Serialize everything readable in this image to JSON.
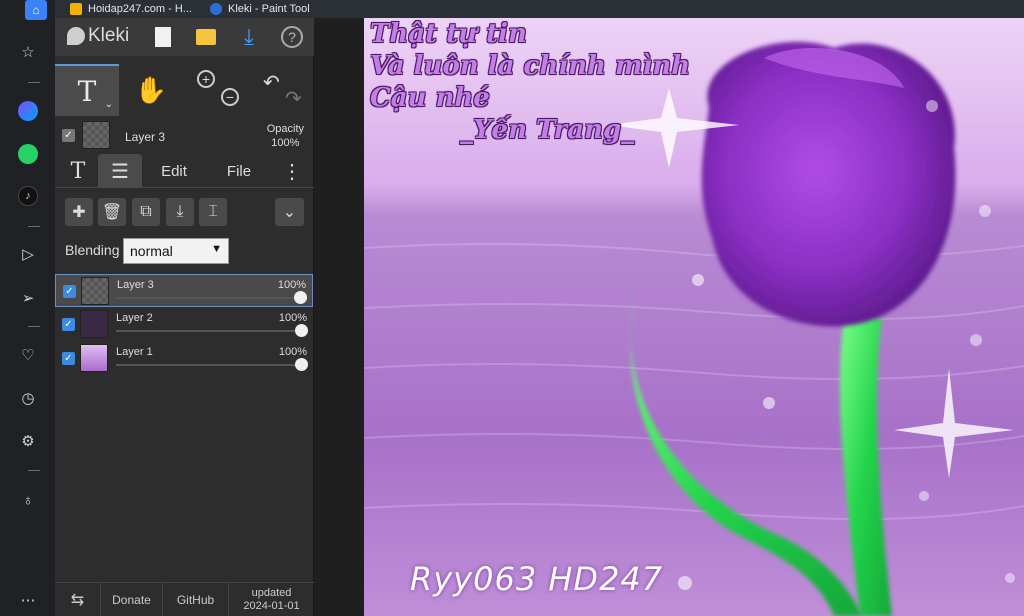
{
  "browser": {
    "tabs": [
      {
        "title": "Hoidap247.com - H..."
      },
      {
        "title": "Kleki - Paint Tool"
      }
    ]
  },
  "rail": {
    "icons": [
      "home-icon",
      "star-icon",
      "messenger-icon",
      "whatsapp-icon",
      "tiktok-icon",
      "play-icon",
      "send-icon",
      "heart-icon",
      "clock-icon",
      "settings-icon",
      "bulb-icon",
      "more-icon"
    ]
  },
  "kleki": {
    "logo": "Kleki",
    "tools": {
      "text_tool": "T"
    },
    "current_layer": {
      "name": "Layer 3",
      "opacity_label": "Opacity",
      "opacity_value": "100%"
    },
    "tabs": {
      "text": "T",
      "edit": "Edit",
      "file": "File"
    },
    "blending": {
      "label": "Blending",
      "value": "normal"
    },
    "layers": [
      {
        "name": "Layer 3",
        "opacity": "100%",
        "opacity_fraction": 1.0,
        "checked": true,
        "active": true
      },
      {
        "name": "Layer 2",
        "opacity": "100%",
        "opacity_fraction": 1.0,
        "checked": true,
        "active": false
      },
      {
        "name": "Layer 1",
        "opacity": "100%",
        "opacity_fraction": 1.0,
        "checked": true,
        "active": false
      }
    ],
    "footer": {
      "donate": "Donate",
      "github": "GitHub",
      "updated_label": "updated",
      "updated_date": "2024-01-01"
    }
  },
  "artwork": {
    "caption_line1": "Thật tự tin",
    "caption_line2": "Và luôn là chính mình",
    "caption_line3": "Cậu nhé",
    "caption_line4": "_Yến Trang_",
    "signature": "Ryy063 HD247",
    "colors": {
      "sky": "#e8c8f3",
      "water": "#b984d3",
      "petal": "#8a2fc4",
      "stem": "#22d34a"
    }
  }
}
